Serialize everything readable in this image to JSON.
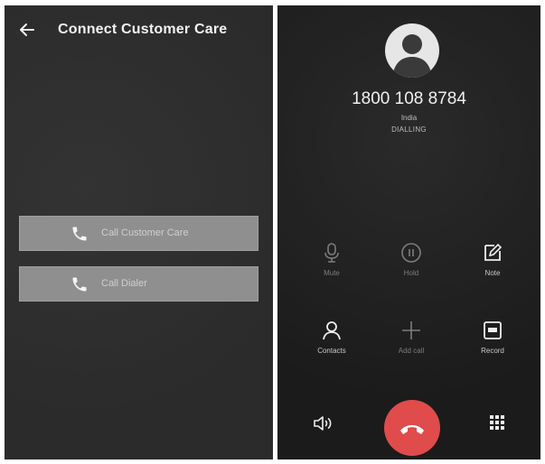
{
  "left": {
    "title": "Connect Customer Care",
    "buttons": [
      {
        "label": "Call Customer Care"
      },
      {
        "label": "Call Dialer"
      }
    ]
  },
  "right": {
    "number": "1800 108 8784",
    "country": "India",
    "status": "DIALLING",
    "controls": [
      {
        "label": "Mute",
        "icon": "mic-icon",
        "enabled": false
      },
      {
        "label": "Hold",
        "icon": "pause-icon",
        "enabled": false
      },
      {
        "label": "Note",
        "icon": "note-icon",
        "enabled": true
      },
      {
        "label": "Contacts",
        "icon": "person-icon",
        "enabled": true
      },
      {
        "label": "Add call",
        "icon": "plus-icon",
        "enabled": false
      },
      {
        "label": "Record",
        "icon": "record-icon",
        "enabled": true
      }
    ]
  },
  "colors": {
    "end_call": "#e04b4b",
    "button_bg": "#8f8f8f"
  }
}
